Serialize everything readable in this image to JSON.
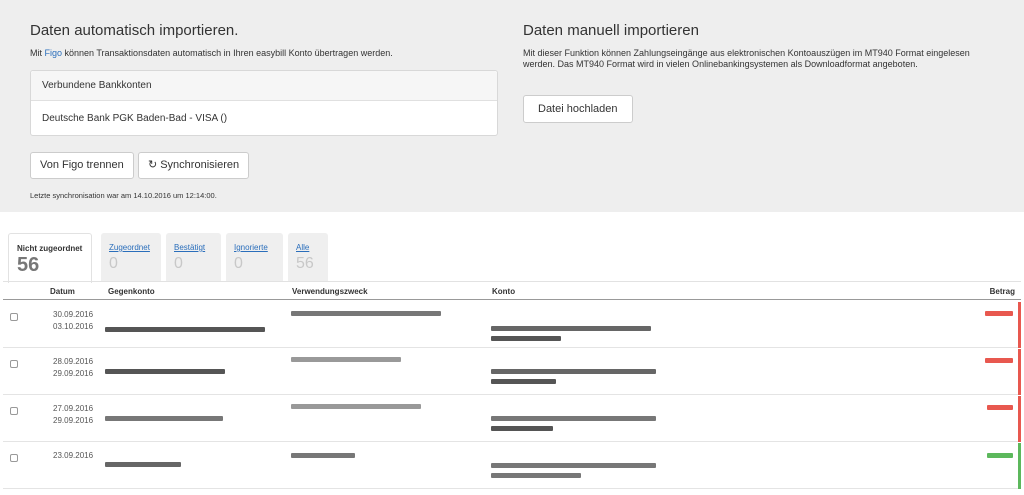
{
  "auto_import": {
    "title": "Daten automatisch importieren.",
    "desc_prefix": "Mit ",
    "desc_link": "Figo",
    "desc_suffix": " können Transaktionsdaten automatisch in Ihren easybill Konto übertragen werden.",
    "accounts_header": "Verbundene Bankkonten",
    "account": "Deutsche Bank PGK Baden-Bad - VISA ()",
    "disconnect_label": "Von Figo trennen",
    "sync_label": "Synchronisieren",
    "last_sync": "Letzte synchronisation war am 14.10.2016 um 12:14:00."
  },
  "manual_import": {
    "title": "Daten manuell importieren",
    "desc": "Mit dieser Funktion können Zahlungseingänge aus elektronischen Kontoauszügen im MT940 Format eingelesen werden. Das MT940 Format wird in vielen Onlinebankingsystemen als Downloadformat angeboten.",
    "upload_label": "Datei hochladen"
  },
  "tabs": [
    {
      "label": "Nicht zugeordnet",
      "count": "56"
    },
    {
      "label": "Zugeordnet",
      "count": "0"
    },
    {
      "label": "Bestätigt",
      "count": "0"
    },
    {
      "label": "Ignorierte",
      "count": "0"
    },
    {
      "label": "Alle",
      "count": "56"
    }
  ],
  "table": {
    "headers": {
      "datum": "Datum",
      "gegenkonto": "Gegenkonto",
      "verwendungszweck": "Verwendungszweck",
      "konto": "Konto",
      "betrag": "Betrag"
    },
    "rows": [
      {
        "date1": "30.09.2016",
        "date2": "03.10.2016",
        "status": "negative"
      },
      {
        "date1": "28.09.2016",
        "date2": "29.09.2016",
        "status": "negative"
      },
      {
        "date1": "27.09.2016",
        "date2": "29.09.2016",
        "status": "negative"
      },
      {
        "date1": "23.09.2016",
        "date2": "",
        "status": "positive"
      }
    ]
  },
  "colors": {
    "link": "#2a6ebb",
    "negative": "#e8584f",
    "positive": "#5cb85c",
    "panel": "#eeeeee"
  },
  "icons": {
    "sync": "refresh-icon",
    "checkbox": "checkbox-icon"
  }
}
